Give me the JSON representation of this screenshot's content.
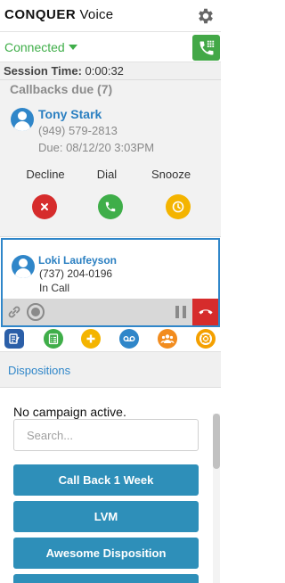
{
  "header": {
    "brand_bold": "CONQUER",
    "brand_rest": " Voice"
  },
  "status": {
    "connection": "Connected"
  },
  "session": {
    "label": "Session Time:",
    "value": "0:00:32"
  },
  "callbacks": {
    "title": "Callbacks due (7)",
    "contact": {
      "name": "Tony Stark",
      "phone": "(949) 579-2813",
      "due": "Due: 08/12/20 3:03PM"
    },
    "actions": {
      "decline": "Decline",
      "dial": "Dial",
      "snooze": "Snooze"
    }
  },
  "active_call": {
    "name": "Loki Laufeyson",
    "phone": "(737) 204-0196",
    "status": "In Call"
  },
  "dispositions": {
    "header": "Dispositions",
    "no_campaign": "No campaign active.",
    "search_placeholder": "Search...",
    "buttons": [
      "Call Back 1 Week",
      "LVM",
      "Awesome Disposition"
    ]
  },
  "colors": {
    "brand_blue": "#2f86c9",
    "connected_green": "#3fae49",
    "decline_red": "#d62c2c",
    "dial_green": "#3fae49",
    "snooze_yellow": "#f4b400",
    "disposition_button": "#2e8fb9"
  }
}
